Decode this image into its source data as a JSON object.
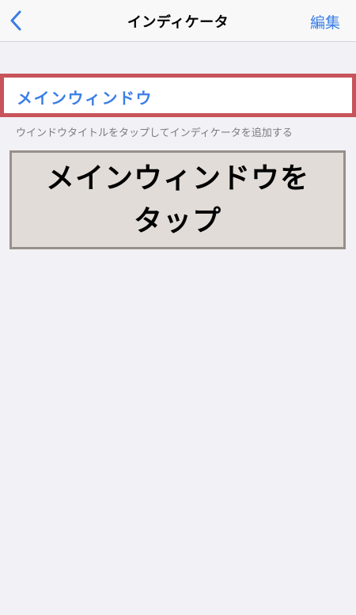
{
  "navbar": {
    "back_icon": "chevron-left-icon",
    "title": "インディケータ",
    "edit_label": "編集",
    "accent_color": "#3a7ee6"
  },
  "list": {
    "main_window_label": "メインウィンドウ",
    "footer_note": "ウインドウタイトルをタップしてインディケータを追加する",
    "highlight_color": "#c8545b"
  },
  "callout": {
    "text": "メインウィンドウを\nタップ"
  }
}
